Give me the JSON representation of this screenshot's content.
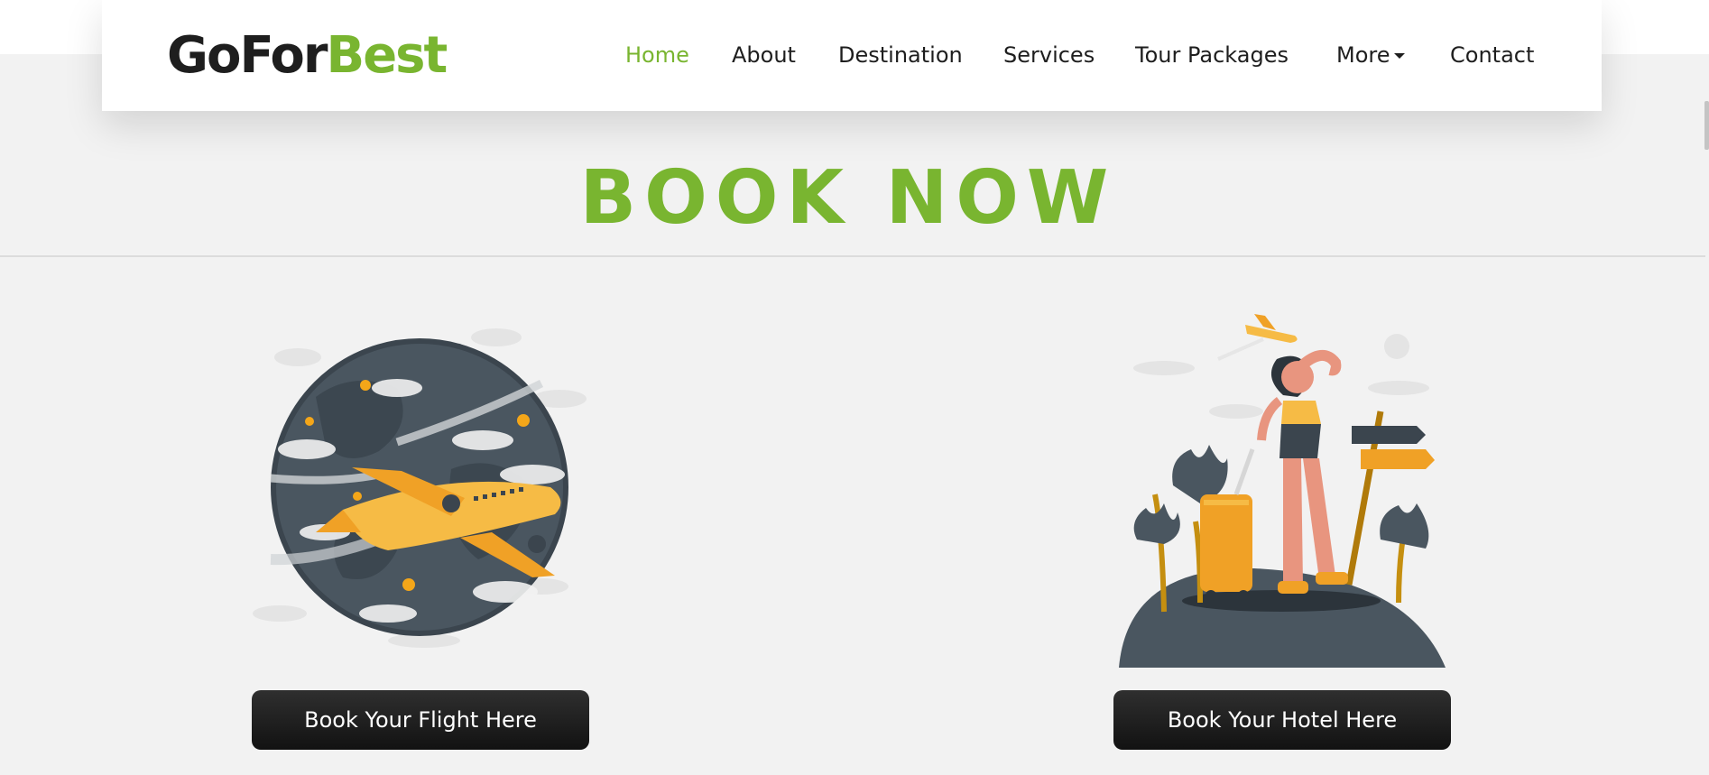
{
  "brand": {
    "part1": "GoFor",
    "part2": "Best",
    "accent_color": "#79b530"
  },
  "nav": {
    "home": "Home",
    "about": "About",
    "destination": "Destination",
    "services": "Services",
    "tour_packages": "Tour Packages",
    "more": "More",
    "contact": "Contact"
  },
  "main": {
    "heading": "BOOK NOW",
    "flight_button": "Book Your Flight Here",
    "hotel_button": "Book Your Hotel Here"
  },
  "icons": [
    "dropdown-caret-icon",
    "flight-globe-illustration",
    "traveler-hotel-illustration"
  ]
}
